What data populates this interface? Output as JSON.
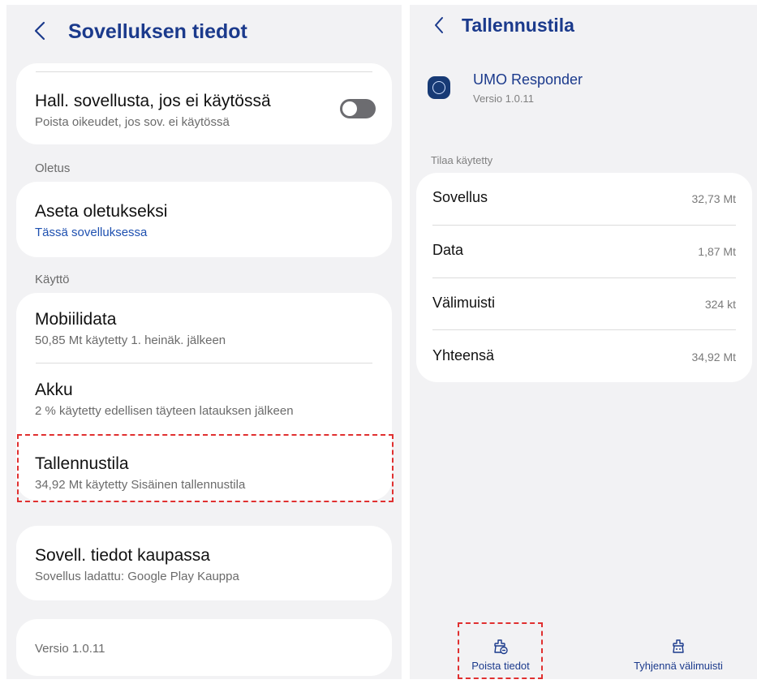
{
  "left": {
    "header": {
      "title": "Sovelluksen tiedot"
    },
    "manage_item": {
      "title": "Hall. sovellusta, jos ei käytössä",
      "subtitle": "Poista oikeudet, jos sov. ei käytössä",
      "toggle_on": false
    },
    "section_default": "Oletus",
    "default_item": {
      "title": "Aseta oletukseksi",
      "subtitle": "Tässä sovelluksessa"
    },
    "section_usage": "Käyttö",
    "usage_items": [
      {
        "title": "Mobiilidata",
        "subtitle": "50,85 Mt käytetty 1. heinäk. jälkeen"
      },
      {
        "title": "Akku",
        "subtitle": "2 % käytetty edellisen täyteen latauksen jälkeen"
      },
      {
        "title": "Tallennustila",
        "subtitle": "34,92 Mt käytetty Sisäinen tallennustila"
      }
    ],
    "store_item": {
      "title": "Sovell. tiedot kaupassa",
      "subtitle": "Sovellus ladattu: Google Play Kauppa"
    },
    "version": "Versio 1.0.11"
  },
  "right": {
    "header": {
      "title": "Tallennustila"
    },
    "app": {
      "name": "UMO Responder",
      "version": "Versio 1.0.11"
    },
    "section_label": "Tilaa käytetty",
    "rows": [
      {
        "label": "Sovellus",
        "value": "32,73 Mt"
      },
      {
        "label": "Data",
        "value": "1,87 Mt"
      },
      {
        "label": "Välimuisti",
        "value": "324 kt"
      },
      {
        "label": "Yhteensä",
        "value": "34,92 Mt"
      }
    ],
    "buttons": {
      "clear_data": "Poista tiedot",
      "clear_cache": "Tyhjennä välimuisti"
    }
  },
  "colors": {
    "accent": "#1b3a8c",
    "link": "#1e50b0",
    "highlight": "#e03030",
    "background": "#f2f2f4"
  }
}
